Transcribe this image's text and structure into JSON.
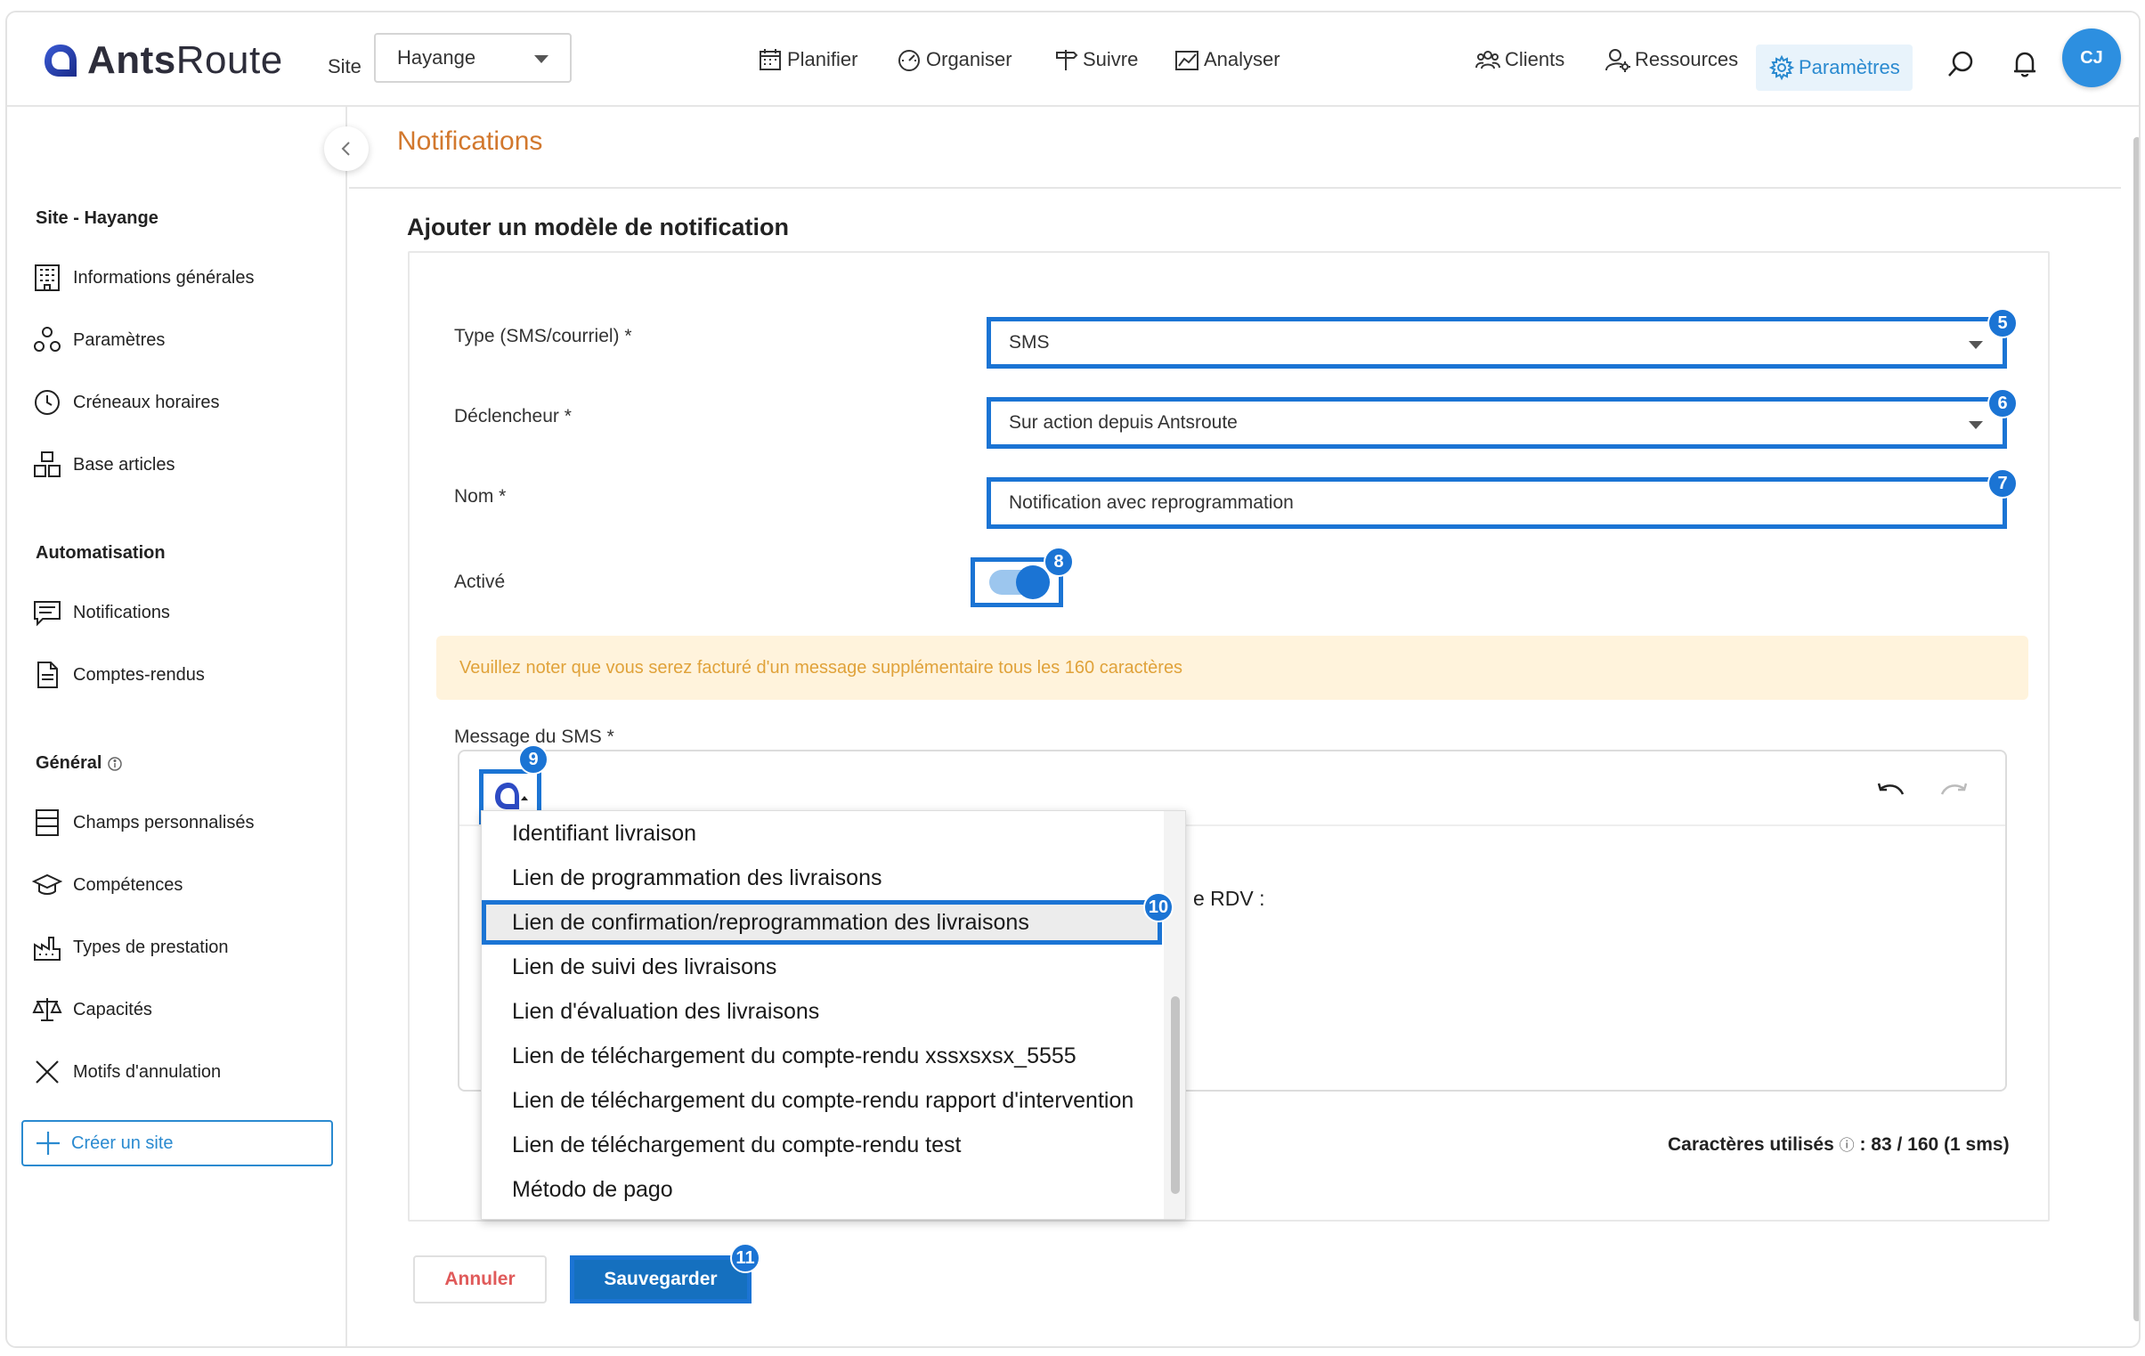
{
  "app": {
    "brand_part1": "Ants",
    "brand_part2": "Route"
  },
  "header": {
    "site_label": "Site",
    "site_value": "Hayange",
    "nav": [
      {
        "label": "Planifier",
        "icon": "calendar-icon"
      },
      {
        "label": "Organiser",
        "icon": "gauge-icon"
      },
      {
        "label": "Suivre",
        "icon": "signpost-icon"
      },
      {
        "label": "Analyser",
        "icon": "chart-icon"
      },
      {
        "label": "Clients",
        "icon": "users-icon"
      },
      {
        "label": "Ressources",
        "icon": "user-gear-icon"
      },
      {
        "label": "Paramètres",
        "icon": "gear-icon"
      }
    ],
    "avatar_initials": "CJ"
  },
  "sidebar": {
    "site_heading": "Site - Hayange",
    "site_items": [
      {
        "label": "Informations générales",
        "icon": "building-icon"
      },
      {
        "label": "Paramètres",
        "icon": "settings-nodes-icon"
      },
      {
        "label": "Créneaux horaires",
        "icon": "clock-icon"
      },
      {
        "label": "Base articles",
        "icon": "boxes-icon"
      }
    ],
    "automation_heading": "Automatisation",
    "automation_items": [
      {
        "label": "Notifications",
        "icon": "message-icon"
      },
      {
        "label": "Comptes-rendus",
        "icon": "document-icon"
      }
    ],
    "general_heading": "Général",
    "general_items": [
      {
        "label": "Champs personnalisés",
        "icon": "list-icon"
      },
      {
        "label": "Compétences",
        "icon": "graduation-cap-icon"
      },
      {
        "label": "Types de prestation",
        "icon": "factory-icon"
      },
      {
        "label": "Capacités",
        "icon": "scale-icon"
      },
      {
        "label": "Motifs d'annulation",
        "icon": "x-icon"
      }
    ],
    "create_site": "Créer un site"
  },
  "main": {
    "page_title": "Notifications",
    "form_title": "Ajouter un modèle de notification",
    "type_label": "Type (SMS/courriel) *",
    "type_value": "SMS",
    "trigger_label": "Déclencheur *",
    "trigger_value": "Sur action depuis Antsroute",
    "name_label": "Nom *",
    "name_value": "Notification avec reprogrammation",
    "active_label": "Activé",
    "active_value": true,
    "notice": "Veuillez noter que vous serez facturé d'un message supplémentaire tous les 160 caractères",
    "message_label": "Message du SMS *",
    "editor_visible_text": "e RDV :",
    "dropdown_items": [
      "Identifiant livraison",
      "Lien de programmation des livraisons",
      "Lien de confirmation/reprogrammation des livraisons",
      "Lien de suivi des livraisons",
      "Lien d'évaluation des livraisons",
      "Lien de téléchargement du compte-rendu xssxsxsx_5555",
      "Lien de téléchargement du compte-rendu rapport d'intervention",
      "Lien de téléchargement du compte-rendu test",
      "Método de pago"
    ],
    "chars_label": "Caractères utilisés",
    "chars_value": ": 83 / 160 (1 sms)",
    "cancel": "Annuler",
    "save": "Sauvegarder"
  },
  "badges": [
    "5",
    "6",
    "7",
    "8",
    "9",
    "10",
    "11"
  ],
  "colors": {
    "accent": "#1b74d4",
    "title_orange": "#d2782e",
    "notice_bg": "#fff3dc",
    "notice_text": "#e0a23a",
    "cancel_text": "#e05a5a"
  }
}
